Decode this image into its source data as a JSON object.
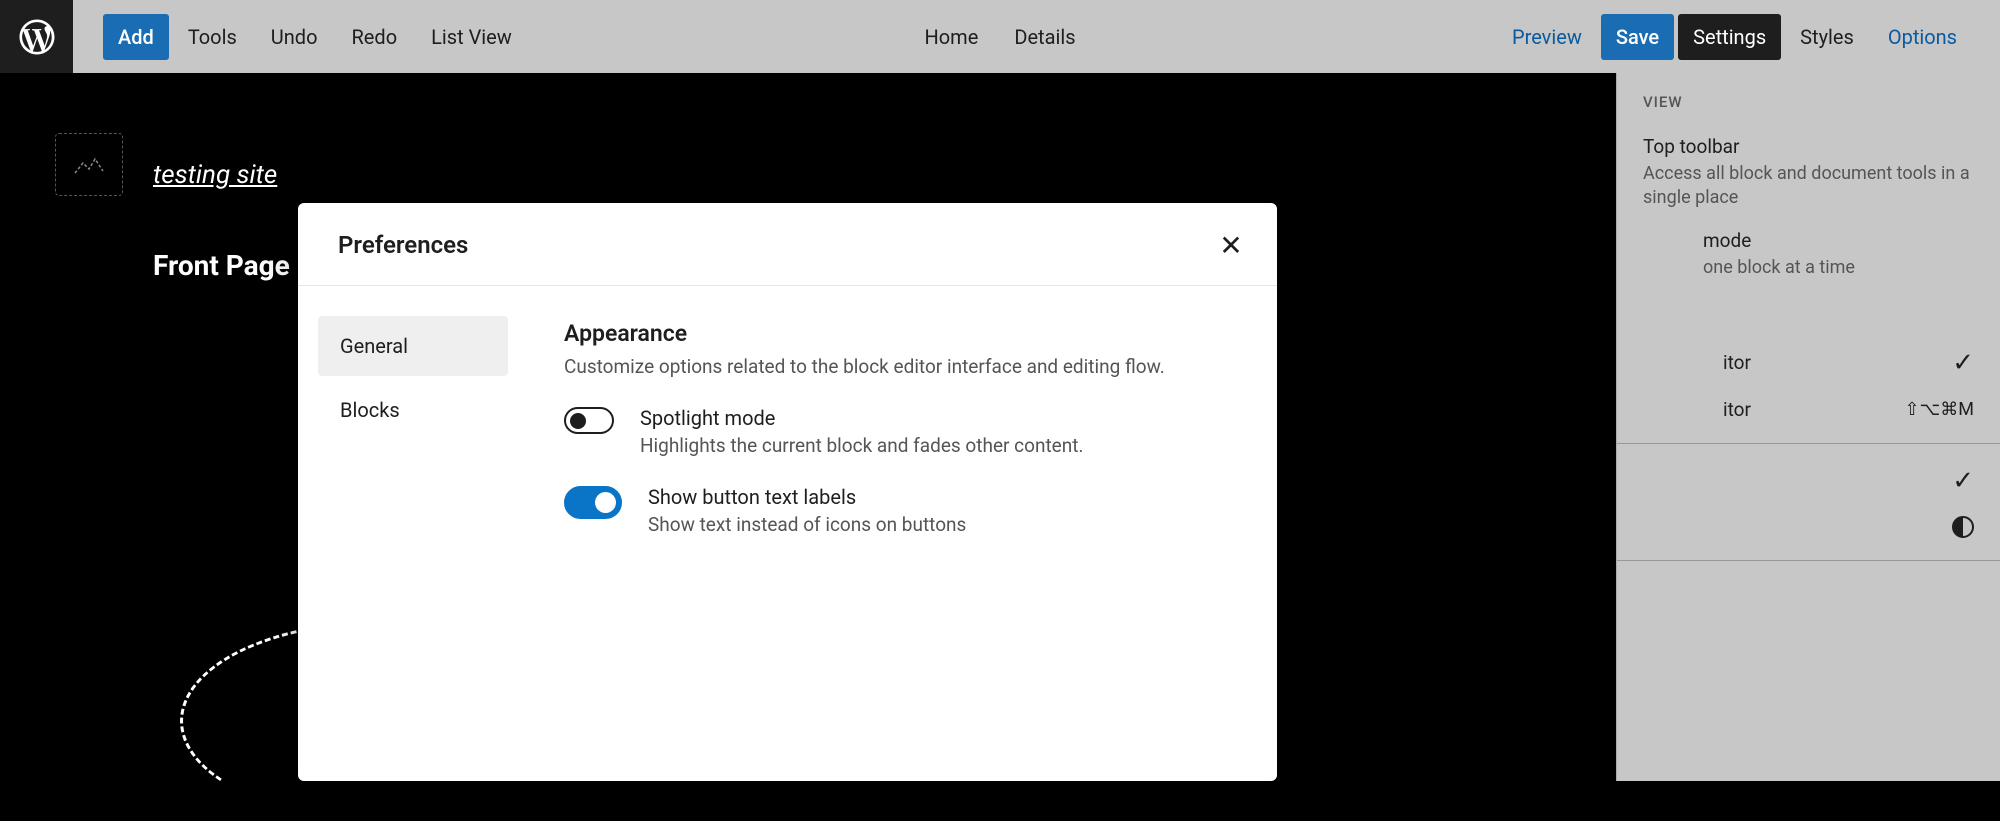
{
  "topbar": {
    "add": "Add",
    "tools": "Tools",
    "undo": "Undo",
    "redo": "Redo",
    "listview": "List View",
    "home": "Home",
    "details": "Details",
    "preview": "Preview",
    "save": "Save",
    "settings": "Settings",
    "styles": "Styles",
    "options": "Options"
  },
  "canvas": {
    "site_title": "testing site",
    "page_title": "Front Page"
  },
  "sidebar": {
    "view_label": "VIEW",
    "items": [
      {
        "title": "Top toolbar",
        "desc": "Access all block and document tools in a single place"
      },
      {
        "title": "mode",
        "desc": "one block at a time"
      }
    ],
    "rows": [
      {
        "label": "itor",
        "right_icon": "check"
      },
      {
        "label": "itor",
        "right_text": "⇧⌥⌘M"
      }
    ],
    "bottom_rows": [
      {
        "right_icon": "check"
      },
      {
        "right_icon": "contrast"
      }
    ]
  },
  "modal": {
    "title": "Preferences",
    "tabs": [
      "General",
      "Blocks"
    ],
    "section": {
      "title": "Appearance",
      "desc": "Customize options related to the block editor interface and editing flow."
    },
    "toggles": [
      {
        "on": false,
        "title": "Spotlight mode",
        "desc": "Highlights the current block and fades other content."
      },
      {
        "on": true,
        "title": "Show button text labels",
        "desc": "Show text instead of icons on buttons"
      }
    ]
  }
}
